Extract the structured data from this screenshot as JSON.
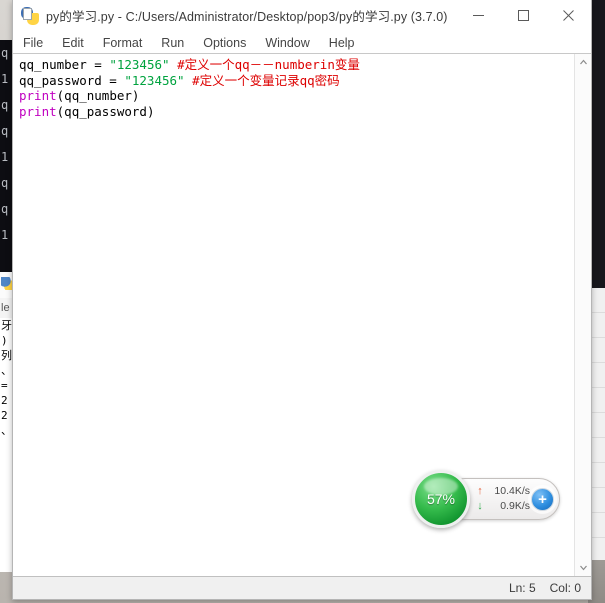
{
  "window": {
    "title": "py的学习.py - C:/Users/Administrator/Desktop/pop3/py的学习.py (3.7.0)",
    "icon": "python-file-icon",
    "buttons": {
      "minimize": "minimize-icon",
      "maximize": "maximize-icon",
      "close": "close-icon"
    }
  },
  "menubar": {
    "items": [
      {
        "label": "File"
      },
      {
        "label": "Edit"
      },
      {
        "label": "Format"
      },
      {
        "label": "Run"
      },
      {
        "label": "Options"
      },
      {
        "label": "Window"
      },
      {
        "label": "Help"
      }
    ]
  },
  "editor": {
    "lines": [
      {
        "tokens": [
          {
            "text": "qq_number = ",
            "type": "plain"
          },
          {
            "text": "\"123456\"",
            "type": "string"
          },
          {
            "text": " ",
            "type": "plain"
          },
          {
            "text": "#定义一个qq－－numberin变量",
            "type": "comment"
          }
        ]
      },
      {
        "tokens": [
          {
            "text": "qq_password = ",
            "type": "plain"
          },
          {
            "text": "\"123456\"",
            "type": "string"
          },
          {
            "text": " ",
            "type": "plain"
          },
          {
            "text": "#定义一个变量记录qq密码",
            "type": "comment"
          }
        ]
      },
      {
        "tokens": [
          {
            "text": "print",
            "type": "builtin"
          },
          {
            "text": "(qq_number)",
            "type": "plain"
          }
        ]
      },
      {
        "tokens": [
          {
            "text": "print",
            "type": "builtin"
          },
          {
            "text": "(qq_password)",
            "type": "plain"
          }
        ]
      }
    ]
  },
  "scrollbar": {
    "up_arrow": "chevron-up-icon",
    "down_arrow": "chevron-down-icon"
  },
  "statusbar": {
    "line": "Ln: 5",
    "column": "Col: 0"
  },
  "net_widget": {
    "cpu_percent": "57%",
    "upload": "10.4K/s",
    "download": "0.9K/s",
    "upload_arrow": "↑",
    "download_arrow": "↓",
    "add_label": "+"
  },
  "background": {
    "console_lines": [
      "q",
      "1",
      "",
      "q",
      "",
      "q",
      "1",
      "",
      "",
      "q",
      "",
      "q",
      "1"
    ],
    "window2_menu": "le",
    "window2_lines": [
      "牙",
      ")",
      "列",
      "、",
      "=",
      "2",
      "2",
      "、"
    ]
  },
  "colors": {
    "string": "#00a33f",
    "comment": "#dd0000",
    "builtin": "#c000c0",
    "accent_green": "#35bb4c",
    "accent_blue": "#2f8fe0"
  }
}
